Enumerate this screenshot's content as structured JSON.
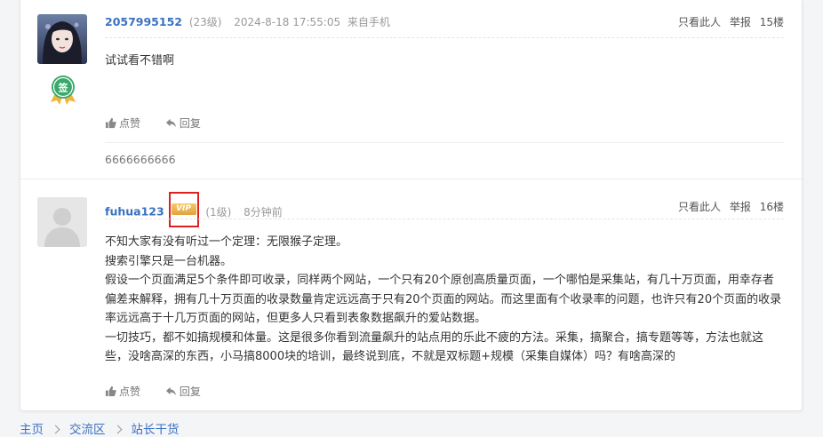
{
  "posts": [
    {
      "username": "2057995152",
      "level": "(23级)",
      "time": "2024-8-18 17:55:05",
      "source": "来自手机",
      "only_this": "只看此人",
      "report": "举报",
      "floor": "15楼",
      "content": [
        "试试看不错啊"
      ],
      "like_label": "点赞",
      "reply_label": "回复",
      "reply_text": "6666666666",
      "medal_char": "签"
    },
    {
      "username": "fuhua123",
      "vip": "VIP",
      "level": "(1级)",
      "time": "8分钟前",
      "only_this": "只看此人",
      "report": "举报",
      "floor": "16楼",
      "content": [
        "不知大家有没有听过一个定理：无限猴子定理。",
        "搜索引擎只是一台机器。",
        "假设一个页面满足5个条件即可收录，同样两个网站，一个只有20个原创高质量页面，一个哪怕是采集站，有几十万页面，用幸存者偏差来解释，拥有几十万页面的收录数量肯定远远高于只有20个页面的网站。而这里面有个收录率的问题，也许只有20个页面的收录率远远高于十几万页面的网站，但更多人只看到表象数据飙升的爱站数据。",
        "一切技巧，都不如搞规模和体量。这是很多你看到流量飙升的站点用的乐此不疲的方法。采集，搞聚合，搞专题等等，方法也就这些，没啥高深的东西，小马搞8000块的培训，最终说到底，不就是双标题+规模（采集自媒体）吗？有啥高深的"
      ],
      "like_label": "点赞",
      "reply_label": "回复"
    }
  ],
  "breadcrumb": [
    "主页",
    "交流区",
    "站长干货"
  ],
  "colors": {
    "link": "#3a71c1",
    "vip_gold": "#e1a23a",
    "highlight_box": "#e02020",
    "medal_green": "#3aa86b"
  }
}
